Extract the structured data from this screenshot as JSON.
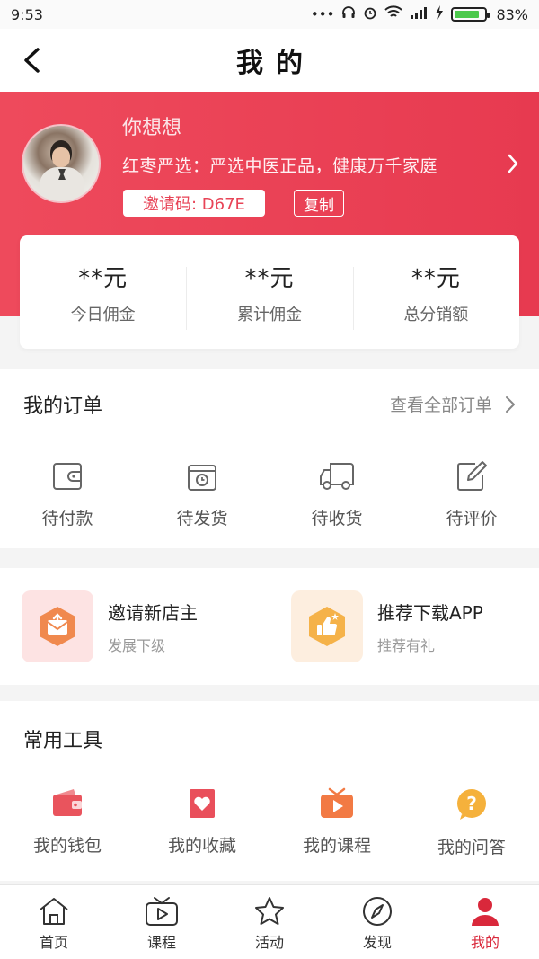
{
  "status_bar": {
    "time": "9:53",
    "battery": "83%",
    "battery_level": 0.83
  },
  "nav": {
    "title": "我的"
  },
  "profile": {
    "name": "你想想",
    "slogan": "红枣严选：严选中医正品，健康万千家庭",
    "invite_code": "邀请码: D67E",
    "copy_label": "复制"
  },
  "stats": [
    {
      "value": "**元",
      "label": "今日佣金"
    },
    {
      "value": "**元",
      "label": "累计佣金"
    },
    {
      "value": "**元",
      "label": "总分销额"
    }
  ],
  "orders": {
    "title": "我的订单",
    "view_all": "查看全部订单",
    "items": [
      {
        "label": "待付款",
        "icon": "wallet-icon"
      },
      {
        "label": "待发货",
        "icon": "package-clock-icon"
      },
      {
        "label": "待收货",
        "icon": "truck-icon"
      },
      {
        "label": "待评价",
        "icon": "edit-icon"
      }
    ]
  },
  "promo": [
    {
      "title": "邀请新店主",
      "subtitle": "发展下级",
      "icon": "invite-envelope-icon",
      "bg": "#fde3e3",
      "accent": "#f0894e"
    },
    {
      "title": "推荐下载APP",
      "subtitle": "推荐有礼",
      "icon": "thumbs-up-icon",
      "bg": "#fdeedf",
      "accent": "#f5b249"
    }
  ],
  "tools": {
    "title": "常用工具",
    "items": [
      {
        "label": "我的钱包",
        "icon": "wallet-icon",
        "color": "#e9545d"
      },
      {
        "label": "我的收藏",
        "icon": "heart-icon",
        "color": "#e94f5b"
      },
      {
        "label": "我的课程",
        "icon": "tv-play-icon",
        "color": "#f27a44"
      },
      {
        "label": "我的问答",
        "icon": "question-icon",
        "color": "#f5b13c"
      }
    ]
  },
  "tabs": [
    {
      "label": "首页",
      "icon": "home-icon"
    },
    {
      "label": "课程",
      "icon": "tv-icon"
    },
    {
      "label": "活动",
      "icon": "star-icon"
    },
    {
      "label": "发现",
      "icon": "compass-icon"
    },
    {
      "label": "我的",
      "icon": "user-icon",
      "active": true
    }
  ],
  "colors": {
    "brand": "#e8414f",
    "active_tab": "#d9283b"
  }
}
